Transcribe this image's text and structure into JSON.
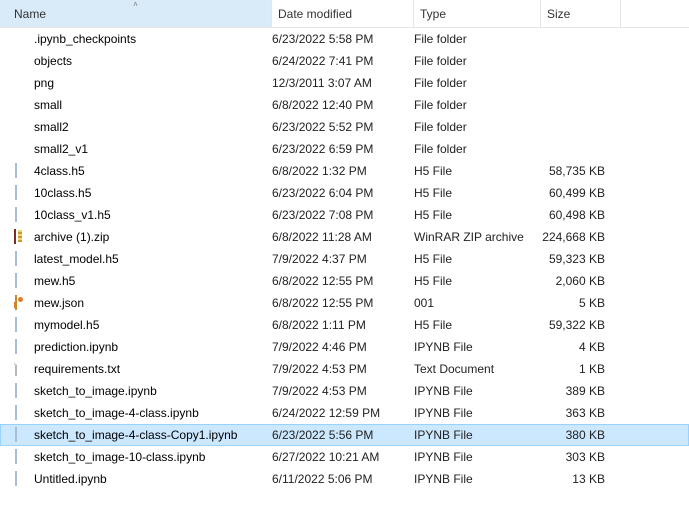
{
  "columns": {
    "name": "Name",
    "date": "Date modified",
    "type": "Type",
    "size": "Size"
  },
  "sort": {
    "column": "name",
    "direction": "asc",
    "glyph": "˄"
  },
  "selected_index": 18,
  "files": [
    {
      "icon": "folder",
      "name": ".ipynb_checkpoints",
      "date": "6/23/2022 5:58 PM",
      "type": "File folder",
      "size": ""
    },
    {
      "icon": "folder",
      "name": "objects",
      "date": "6/24/2022 7:41 PM",
      "type": "File folder",
      "size": ""
    },
    {
      "icon": "folder",
      "name": "png",
      "date": "12/3/2011 3:07 AM",
      "type": "File folder",
      "size": ""
    },
    {
      "icon": "folder",
      "name": "small",
      "date": "6/8/2022 12:40 PM",
      "type": "File folder",
      "size": ""
    },
    {
      "icon": "folder",
      "name": "small2",
      "date": "6/23/2022 5:52 PM",
      "type": "File folder",
      "size": ""
    },
    {
      "icon": "folder",
      "name": "small2_v1",
      "date": "6/23/2022 6:59 PM",
      "type": "File folder",
      "size": ""
    },
    {
      "icon": "ipynb",
      "name": "4class.h5",
      "date": "6/8/2022 1:32 PM",
      "type": "H5 File",
      "size": "58,735 KB"
    },
    {
      "icon": "ipynb",
      "name": "10class.h5",
      "date": "6/23/2022 6:04 PM",
      "type": "H5 File",
      "size": "60,499 KB"
    },
    {
      "icon": "ipynb",
      "name": "10class_v1.h5",
      "date": "6/23/2022 7:08 PM",
      "type": "H5 File",
      "size": "60,498 KB"
    },
    {
      "icon": "zip",
      "name": "archive (1).zip",
      "date": "6/8/2022 11:28 AM",
      "type": "WinRAR ZIP archive",
      "size": "224,668 KB"
    },
    {
      "icon": "ipynb",
      "name": "latest_model.h5",
      "date": "7/9/2022 4:37 PM",
      "type": "H5 File",
      "size": "59,323 KB"
    },
    {
      "icon": "ipynb",
      "name": "mew.h5",
      "date": "6/8/2022 12:55 PM",
      "type": "H5 File",
      "size": "2,060 KB"
    },
    {
      "icon": "json",
      "name": "mew.json",
      "date": "6/8/2022 12:55 PM",
      "type": "001",
      "size": "5 KB"
    },
    {
      "icon": "ipynb",
      "name": "mymodel.h5",
      "date": "6/8/2022 1:11 PM",
      "type": "H5 File",
      "size": "59,322 KB"
    },
    {
      "icon": "ipynb",
      "name": "prediction.ipynb",
      "date": "7/9/2022 4:46 PM",
      "type": "IPYNB File",
      "size": "4 KB"
    },
    {
      "icon": "file",
      "name": "requirements.txt",
      "date": "7/9/2022 4:53 PM",
      "type": "Text Document",
      "size": "1 KB"
    },
    {
      "icon": "ipynb",
      "name": "sketch_to_image.ipynb",
      "date": "7/9/2022 4:53 PM",
      "type": "IPYNB File",
      "size": "389 KB"
    },
    {
      "icon": "ipynb",
      "name": "sketch_to_image-4-class.ipynb",
      "date": "6/24/2022 12:59 PM",
      "type": "IPYNB File",
      "size": "363 KB"
    },
    {
      "icon": "ipynb",
      "name": "sketch_to_image-4-class-Copy1.ipynb",
      "date": "6/23/2022 5:56 PM",
      "type": "IPYNB File",
      "size": "380 KB"
    },
    {
      "icon": "ipynb",
      "name": "sketch_to_image-10-class.ipynb",
      "date": "6/27/2022 10:21 AM",
      "type": "IPYNB File",
      "size": "303 KB"
    },
    {
      "icon": "ipynb",
      "name": "Untitled.ipynb",
      "date": "6/11/2022 5:06 PM",
      "type": "IPYNB File",
      "size": "13 KB"
    }
  ]
}
